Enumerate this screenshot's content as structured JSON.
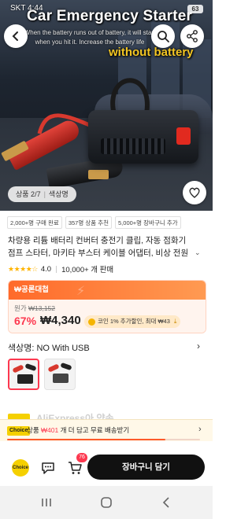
{
  "status_bar": {
    "carrier": "SKT 4:44",
    "battery": "63"
  },
  "hero": {
    "overlay_title": "Car Emergency Starter",
    "overlay_subtitle": "When the battery runs out of battery, it will start when you hit it. Increase the battery life",
    "overlay_badge": "without battery",
    "page_indicator": "상품 2/7",
    "page_indicator_sub": "색상명"
  },
  "tags": [
    "2,000+명 구매 완료",
    "357명 상품 추천",
    "5,000+명 장바구니 추가"
  ],
  "product": {
    "title_line1": "차량용 리튬 배터리 컨버터 충전기 클립, 자동 점화기",
    "title_line2": "점프 스타터, 마키타 부스터 케이블 어댑터, 비상 전원",
    "rating": "4.0",
    "sold": "10,000+ 개 판매"
  },
  "deal": {
    "header": "₩공론대첩",
    "original_label": "원가",
    "original_price": "₩13,152",
    "discount": "67%",
    "price": "₩4,340",
    "coin_text": "코인 1% 추가할인, 최대 ₩43"
  },
  "color": {
    "label": "색상명: NO With USB",
    "options": [
      "NO With USB",
      "With USB"
    ]
  },
  "promo": {
    "peek_text": "AliExpress아 약속",
    "choice_tag": "Choice",
    "text_before": "상품",
    "amount": "₩401",
    "text_after": "개 더 담고 무료 배송받기",
    "progress": 0.82
  },
  "bottom_bar": {
    "choice_label": "Choice",
    "cart_count": "76",
    "add_to_cart": "장바구니 담기"
  },
  "colors": {
    "accent": "#fd384f",
    "deal_orange": "#ff6a2a",
    "choice_yellow": "#f5d000"
  }
}
